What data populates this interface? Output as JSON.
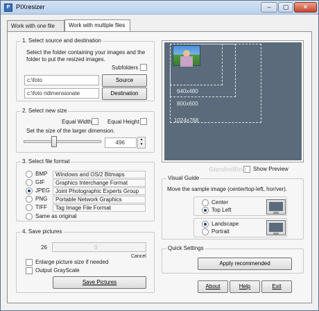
{
  "window": {
    "title": "PIXresizer",
    "min": "–",
    "max": "▢",
    "close": "✕"
  },
  "tabs": [
    {
      "label": "Work with one file"
    },
    {
      "label": "Work with multiple files"
    }
  ],
  "source": {
    "title": "1. Select source and destination",
    "desc": "Select the folder containing your images and the folder to put the resized images.",
    "subfolders": "Subfolders",
    "source_path": "c:\\foto",
    "source_btn": "Source",
    "dest_path": "c:\\foto ridimensionate",
    "dest_btn": "Destination"
  },
  "size": {
    "title": "2. Select new size",
    "equal_width": "Equal Width",
    "equal_height": "Equal Height",
    "hint": "Set the size of the larger dimension.",
    "value": "496",
    "spin_up": "▲",
    "spin_down": "▼"
  },
  "format": {
    "title": "3. Select file format",
    "items": [
      {
        "name": "BMP",
        "desc": "Windows and OS/2 Bitmaps",
        "selected": false
      },
      {
        "name": "GIF",
        "desc": "Graphics Interchange Format",
        "selected": false
      },
      {
        "name": "JPEG",
        "desc": "Joint Photographic Experts Group",
        "selected": true
      },
      {
        "name": "PNG",
        "desc": "Portable Network Graphics",
        "selected": false
      },
      {
        "name": "TIFF",
        "desc": "Tag Image File Format",
        "selected": false
      }
    ],
    "same": "Same as original"
  },
  "save": {
    "title": "4. Save pictures",
    "count": "26",
    "progress": "0",
    "cancel": "Cancel",
    "enlarge": "Enlarge picture size if needed",
    "grayscale": "Output GrayScale",
    "save_btn": "Save Pictures"
  },
  "preview": {
    "sizes": [
      "640x480",
      "800x600",
      "1024x768"
    ],
    "show_preview": "Show Preview"
  },
  "watermark": "GiardiniBlog",
  "visual_guide": {
    "title": "Visual Guide",
    "desc": "Move the sample image (center/top-left, hor/ver).",
    "center": "Center",
    "top_left": "Top Left",
    "landscape": "Landscape",
    "portrait": "Portrait"
  },
  "quick": {
    "title": "Quick Settings",
    "apply": "Apply recommended"
  },
  "buttons": {
    "about": "About",
    "help": "Help",
    "exit": "Exit"
  }
}
